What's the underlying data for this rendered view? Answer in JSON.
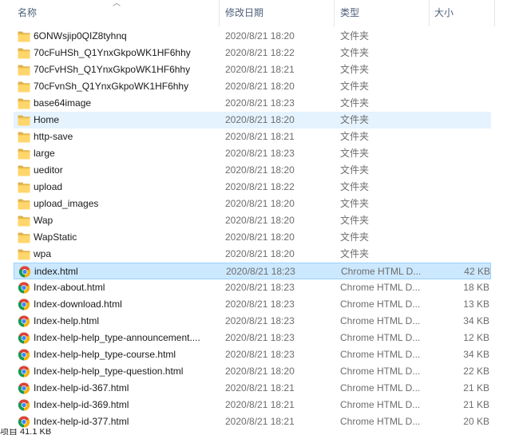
{
  "columns": {
    "name": "名称",
    "date": "修改日期",
    "type": "类型",
    "size": "大小"
  },
  "rows": [
    {
      "name": "6ONWsjip0QIZ8tyhnq",
      "date": "2020/8/21 18:20",
      "type": "文件夹",
      "size": "",
      "icon": "folder-icon"
    },
    {
      "name": "70cFuHSh_Q1YnxGkpoWK1HF6hhy",
      "date": "2020/8/21 18:22",
      "type": "文件夹",
      "size": "",
      "icon": "folder-icon"
    },
    {
      "name": "70cFvHSh_Q1YnxGkpoWK1HF6hhy",
      "date": "2020/8/21 18:21",
      "type": "文件夹",
      "size": "",
      "icon": "folder-icon"
    },
    {
      "name": "70cFvnSh_Q1YnxGkpoWK1HF6hhy",
      "date": "2020/8/21 18:20",
      "type": "文件夹",
      "size": "",
      "icon": "folder-icon"
    },
    {
      "name": "base64image",
      "date": "2020/8/21 18:23",
      "type": "文件夹",
      "size": "",
      "icon": "folder-icon"
    },
    {
      "name": "Home",
      "date": "2020/8/21 18:20",
      "type": "文件夹",
      "size": "",
      "icon": "folder-icon",
      "state": "hover"
    },
    {
      "name": "http-save",
      "date": "2020/8/21 18:21",
      "type": "文件夹",
      "size": "",
      "icon": "folder-icon"
    },
    {
      "name": "large",
      "date": "2020/8/21 18:23",
      "type": "文件夹",
      "size": "",
      "icon": "folder-icon"
    },
    {
      "name": "ueditor",
      "date": "2020/8/21 18:20",
      "type": "文件夹",
      "size": "",
      "icon": "folder-icon"
    },
    {
      "name": "upload",
      "date": "2020/8/21 18:22",
      "type": "文件夹",
      "size": "",
      "icon": "folder-icon"
    },
    {
      "name": "upload_images",
      "date": "2020/8/21 18:20",
      "type": "文件夹",
      "size": "",
      "icon": "folder-icon"
    },
    {
      "name": "Wap",
      "date": "2020/8/21 18:20",
      "type": "文件夹",
      "size": "",
      "icon": "folder-icon"
    },
    {
      "name": "WapStatic",
      "date": "2020/8/21 18:20",
      "type": "文件夹",
      "size": "",
      "icon": "folder-icon"
    },
    {
      "name": "wpa",
      "date": "2020/8/21 18:20",
      "type": "文件夹",
      "size": "",
      "icon": "folder-icon"
    },
    {
      "name": "index.html",
      "date": "2020/8/21 18:23",
      "type": "Chrome HTML D...",
      "size": "42 KB",
      "icon": "chrome-icon",
      "state": "selected"
    },
    {
      "name": "Index-about.html",
      "date": "2020/8/21 18:23",
      "type": "Chrome HTML D...",
      "size": "18 KB",
      "icon": "chrome-icon"
    },
    {
      "name": "Index-download.html",
      "date": "2020/8/21 18:23",
      "type": "Chrome HTML D...",
      "size": "13 KB",
      "icon": "chrome-icon"
    },
    {
      "name": "Index-help.html",
      "date": "2020/8/21 18:23",
      "type": "Chrome HTML D...",
      "size": "34 KB",
      "icon": "chrome-icon"
    },
    {
      "name": "Index-help-help_type-announcement....",
      "date": "2020/8/21 18:23",
      "type": "Chrome HTML D...",
      "size": "12 KB",
      "icon": "chrome-icon"
    },
    {
      "name": "Index-help-help_type-course.html",
      "date": "2020/8/21 18:23",
      "type": "Chrome HTML D...",
      "size": "34 KB",
      "icon": "chrome-icon"
    },
    {
      "name": "Index-help-help_type-question.html",
      "date": "2020/8/21 18:20",
      "type": "Chrome HTML D...",
      "size": "22 KB",
      "icon": "chrome-icon"
    },
    {
      "name": "Index-help-id-367.html",
      "date": "2020/8/21 18:21",
      "type": "Chrome HTML D...",
      "size": "21 KB",
      "icon": "chrome-icon"
    },
    {
      "name": "Index-help-id-369.html",
      "date": "2020/8/21 18:21",
      "type": "Chrome HTML D...",
      "size": "21 KB",
      "icon": "chrome-icon"
    },
    {
      "name": "Index-help-id-377.html",
      "date": "2020/8/21 18:21",
      "type": "Chrome HTML D...",
      "size": "20 KB",
      "icon": "chrome-icon"
    }
  ],
  "status": {
    "text": "项目 41.1 KB"
  }
}
